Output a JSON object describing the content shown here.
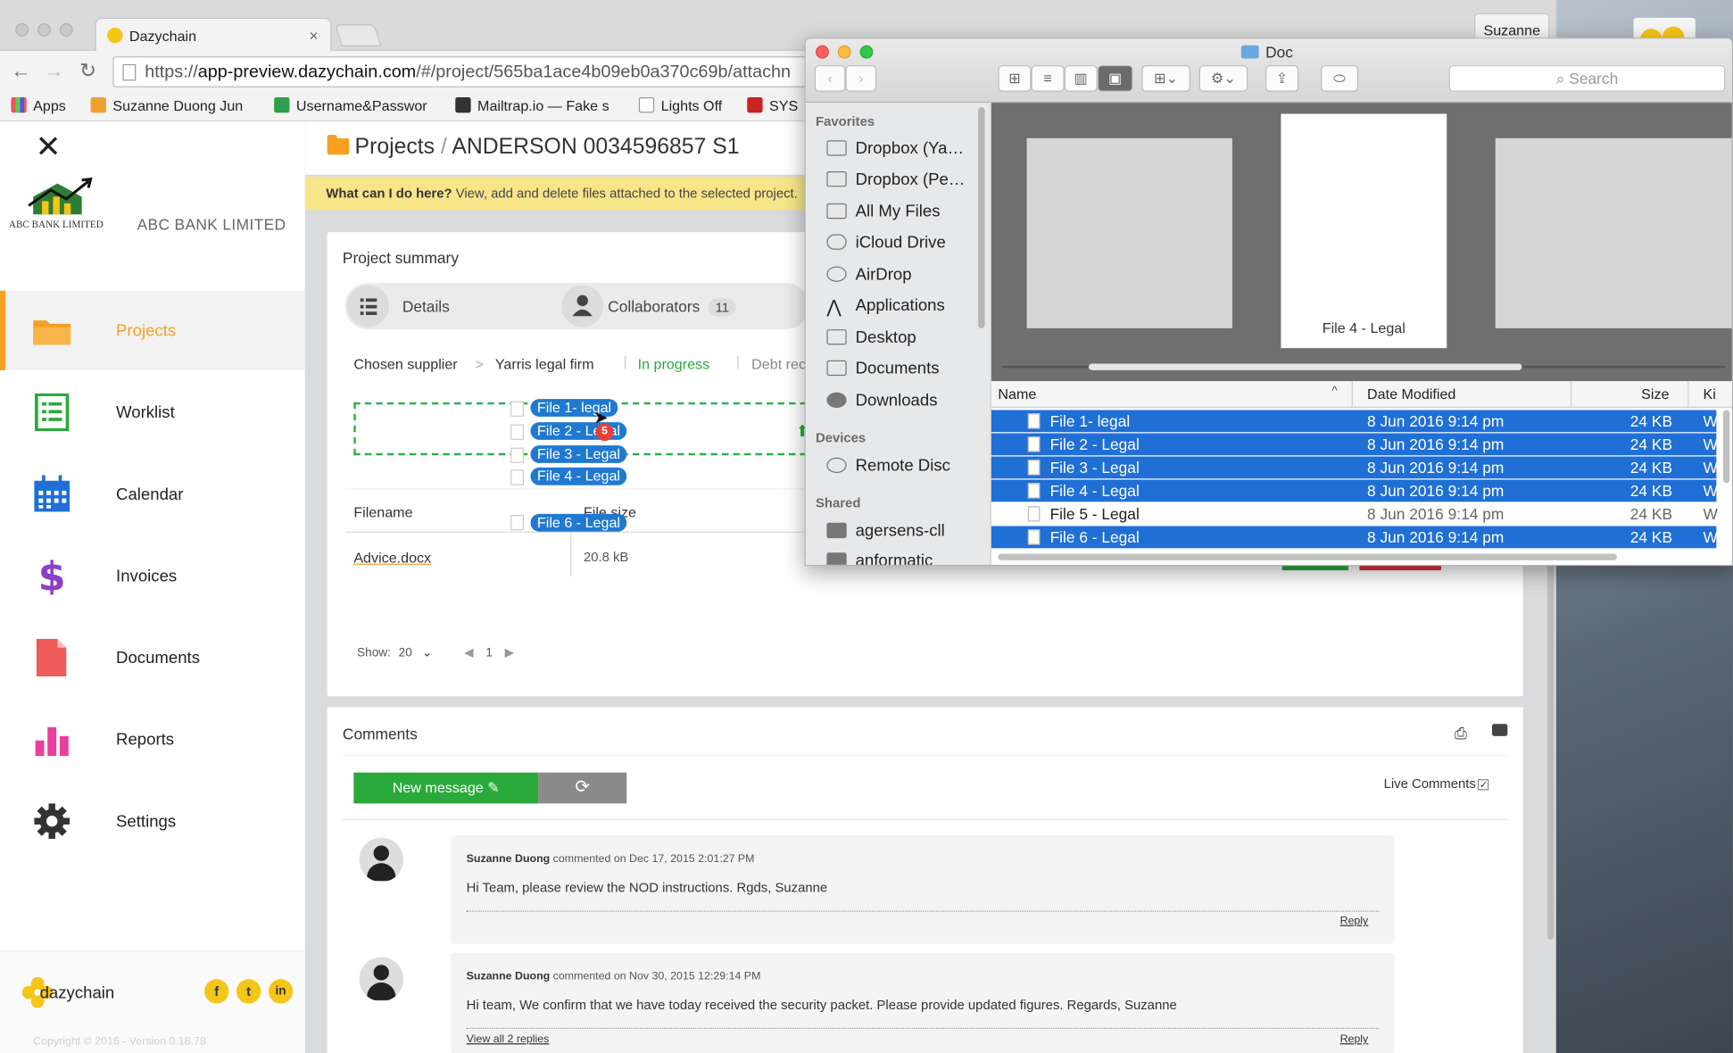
{
  "browser": {
    "tab_title": "Dazychain",
    "tab_close": "×",
    "url_prefix": "https://",
    "url_host": "app-preview.dazychain.com",
    "url_path": "/#/project/565ba1ace4b09eb0a370c69b/attachn",
    "user": "Suzanne",
    "bookmarks": [
      "Apps",
      "Suzanne Duong Jun",
      "Username&Passwor",
      "Mailtrap.io — Fake s",
      "Lights Off",
      "SYS"
    ]
  },
  "sidebar": {
    "close_glyph": "✕",
    "logo_text": "ABC BANK LIMITED",
    "brand": "ABC BANK LIMITED",
    "items": [
      {
        "label": "Projects",
        "icon": "folder-icon",
        "color": "#f5a022"
      },
      {
        "label": "Worklist",
        "icon": "list-icon",
        "color": "#2aaa3a"
      },
      {
        "label": "Calendar",
        "icon": "calendar-icon",
        "color": "#1f6fd6"
      },
      {
        "label": "Invoices",
        "icon": "dollar-icon",
        "color": "#8e3fc7"
      },
      {
        "label": "Documents",
        "icon": "document-icon",
        "color": "#ef5a5a"
      },
      {
        "label": "Reports",
        "icon": "bar-chart-icon",
        "color": "#e8409a"
      },
      {
        "label": "Settings",
        "icon": "gear-icon",
        "color": "#333333"
      }
    ],
    "footer_brand": "dazychain",
    "social": [
      "f",
      "t",
      "in"
    ],
    "copyright": "Copyright © 2016 - Version 0.18.78"
  },
  "main": {
    "crumb_root": "Projects",
    "crumb_sep": "/",
    "crumb_project": "ANDERSON 0034596857 S1",
    "banner_q": "What can I do here?",
    "banner_text": "View, add and delete files attached to the selected project.",
    "summary_title": "Project summary",
    "tab_details": "Details",
    "tab_collaborators": "Collaborators",
    "collaborators_count": "11",
    "supplier_label": "Chosen supplier",
    "supplier_arrow": ">",
    "supplier_name": "Yarris legal firm",
    "status": "In progress",
    "debt_label": "Debt rec",
    "drag_files": [
      "File 1- legal",
      "File 2 - Legal",
      "File 3 - Legal",
      "File 4 - Legal",
      "File 6 - Legal"
    ],
    "drag_count": "5",
    "col_filename": "Filename",
    "col_filesize": "File size",
    "file_name": "Advice.docx",
    "file_size": "20.8 kB",
    "show_label": "Show:",
    "show_value": "20",
    "page": "1",
    "comments_title": "Comments",
    "new_message": "New message",
    "live_comments": "Live Comments",
    "comments": [
      {
        "author": "Suzanne Duong",
        "meta": "commented on Dec 17, 2015 2:01:27 PM",
        "body": "Hi Team, please review the NOD instructions. Rgds, Suzanne",
        "reply": "Reply"
      },
      {
        "author": "Suzanne Duong",
        "meta": "commented on Nov 30, 2015 12:29:14 PM",
        "body": "Hi team, We confirm that we have today received the security packet. Please provide updated figures. Regards, Suzanne",
        "reply": "Reply",
        "view_all": "View all 2 replies"
      }
    ]
  },
  "finder": {
    "title": "Doc",
    "search_placeholder": "Search",
    "sections": {
      "favorites": "Favorites",
      "devices": "Devices",
      "shared": "Shared"
    },
    "favorites": [
      "Dropbox (Ya…",
      "Dropbox (Pe…",
      "All My Files",
      "iCloud Drive",
      "AirDrop",
      "Applications",
      "Desktop",
      "Documents",
      "Downloads"
    ],
    "devices": [
      "Remote Disc"
    ],
    "shared": [
      "agersens-cll",
      "anformatic"
    ],
    "cover_label": "File 4 - Legal",
    "columns": {
      "name": "Name",
      "date": "Date Modified",
      "size": "Size",
      "kind": "Ki"
    },
    "files": [
      {
        "name": "File 1- legal",
        "date": "8 Jun 2016 9:14 pm",
        "size": "24 KB",
        "kind": "W",
        "selected": true
      },
      {
        "name": "File 2 - Legal",
        "date": "8 Jun 2016 9:14 pm",
        "size": "24 KB",
        "kind": "W",
        "selected": true
      },
      {
        "name": "File 3 - Legal",
        "date": "8 Jun 2016 9:14 pm",
        "size": "24 KB",
        "kind": "W",
        "selected": true
      },
      {
        "name": "File 4 - Legal",
        "date": "8 Jun 2016 9:14 pm",
        "size": "24 KB",
        "kind": "W",
        "selected": true
      },
      {
        "name": "File 5 - Legal",
        "date": "8 Jun 2016 9:14 pm",
        "size": "24 KB",
        "kind": "W",
        "selected": false
      },
      {
        "name": "File 6 - Legal",
        "date": "8 Jun 2016 9:14 pm",
        "size": "24 KB",
        "kind": "W",
        "selected": true
      }
    ]
  }
}
